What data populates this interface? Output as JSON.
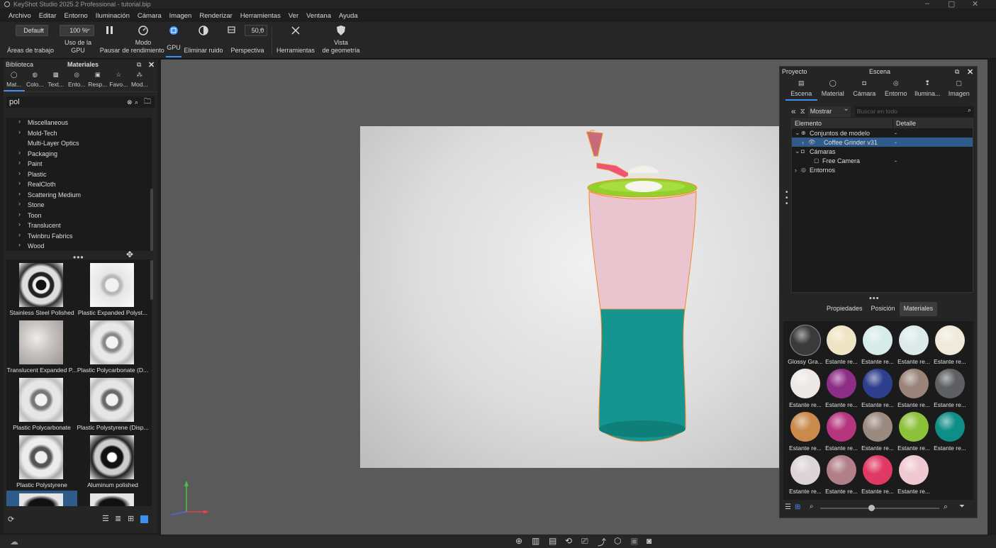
{
  "window": {
    "title": "KeyShot Studio 2025.2 Professional - tutorial.bip",
    "controls": [
      "minimize-icon",
      "restore-icon",
      "close-icon"
    ]
  },
  "menu": [
    "Archivo",
    "Editar",
    "Entorno",
    "Iluminación",
    "Cámara",
    "Imagen",
    "Renderizar",
    "Herramientas",
    "Ver",
    "Ventana",
    "Ayuda"
  ],
  "ribbon": {
    "workspace_value": "Default",
    "workspace_label": "Áreas de trabajo",
    "gpu_usage_value": "100 %",
    "gpu_usage_label": "Uso de la GPU",
    "pause_label": "Pausar",
    "performance_label_1": "Modo",
    "performance_label_2": "de rendimiento",
    "gpu_label": "GPU",
    "denoise_label": "Eliminar ruido",
    "perspective_value": "50,0",
    "perspective_label": "Perspectiva",
    "tools_label": "Herramientas",
    "geometry_label_1": "Vista",
    "geometry_label_2": "de geometría"
  },
  "library": {
    "title": "Biblioteca",
    "section": "Materiales",
    "tabs": [
      "Mat...",
      "Colo...",
      "Text...",
      "Ento...",
      "Resp...",
      "Favo...",
      "Mod..."
    ],
    "search_value": "pol",
    "categories": [
      {
        "label": "Miscellaneous",
        "caret": true
      },
      {
        "label": "Mold-Tech",
        "caret": true
      },
      {
        "label": "Multi-Layer Optics",
        "caret": false
      },
      {
        "label": "Packaging",
        "caret": true
      },
      {
        "label": "Paint",
        "caret": true
      },
      {
        "label": "Plastic",
        "caret": true
      },
      {
        "label": "RealCloth",
        "caret": true
      },
      {
        "label": "Scattering Medium",
        "caret": true
      },
      {
        "label": "Stone",
        "caret": true
      },
      {
        "label": "Toon",
        "caret": true
      },
      {
        "label": "Translucent",
        "caret": true
      },
      {
        "label": "Twinbru Fabrics",
        "caret": true
      },
      {
        "label": "Wood",
        "caret": true
      }
    ],
    "materials": [
      "Stainless Steel Polished",
      "Plastic Expanded Polyst...",
      "Translucent Expanded P...",
      "Plastic Polycarbonate (D...",
      "Plastic Polycarbonate",
      "Plastic Polystyrene (Disp...",
      "Plastic Polystyrene",
      "Aluminum polished"
    ]
  },
  "project": {
    "title": "Proyecto",
    "section": "Escena",
    "tabs": [
      "Escena",
      "Material",
      "Cámara",
      "Entorno",
      "Ilumina...",
      "Imagen"
    ],
    "show_value": "Mostrar",
    "filter_placeholder": "Buscar en todo",
    "columns": [
      "Elemento",
      "Detalle"
    ],
    "tree": [
      {
        "label": "Conjuntos de modelo",
        "detail": "-"
      },
      {
        "label": "Coffee Grinder v31",
        "detail": "-"
      },
      {
        "label": "Cámaras",
        "detail": ""
      },
      {
        "label": "Free Camera",
        "detail": "-"
      },
      {
        "label": "Entornos",
        "detail": ""
      }
    ],
    "subtabs": [
      "Propiedades",
      "Posición",
      "Materiales"
    ],
    "materials": [
      {
        "label": "Glossy Gra...",
        "color": "#3a3a3a"
      },
      {
        "label": "Estante re...",
        "color": "#efe4c3"
      },
      {
        "label": "Estante re...",
        "color": "#d7ece9"
      },
      {
        "label": "Estante re...",
        "color": "#dcebea"
      },
      {
        "label": "Estante re...",
        "color": "#efeadb"
      },
      {
        "label": "Estante re...",
        "color": "#ede8e4"
      },
      {
        "label": "Estante re...",
        "color": "#8d2d86"
      },
      {
        "label": "Estante re...",
        "color": "#2f3f8f"
      },
      {
        "label": "Estante re...",
        "color": "#9a8479"
      },
      {
        "label": "Estante re...",
        "color": "#5d5f63"
      },
      {
        "label": "Estante re...",
        "color": "#c98a4c"
      },
      {
        "label": "Estante re...",
        "color": "#b6357f"
      },
      {
        "label": "Estante re...",
        "color": "#9b8a80"
      },
      {
        "label": "Estante re...",
        "color": "#8cc23a"
      },
      {
        "label": "Estante re...",
        "color": "#0f8e87"
      },
      {
        "label": "Estante re...",
        "color": "#dcd4d8"
      },
      {
        "label": "Estante re...",
        "color": "#b07f88"
      },
      {
        "label": "Estante re...",
        "color": "#e03a64"
      },
      {
        "label": "Estante re...",
        "color": "#efc8d2"
      }
    ]
  },
  "colors": {
    "accent": "#3c8ff0",
    "grinder_top": "#e9c3cf",
    "grinder_bottom": "#13948f",
    "grinder_lid": "#93d02b",
    "selection_outline": "#f08a2a"
  }
}
